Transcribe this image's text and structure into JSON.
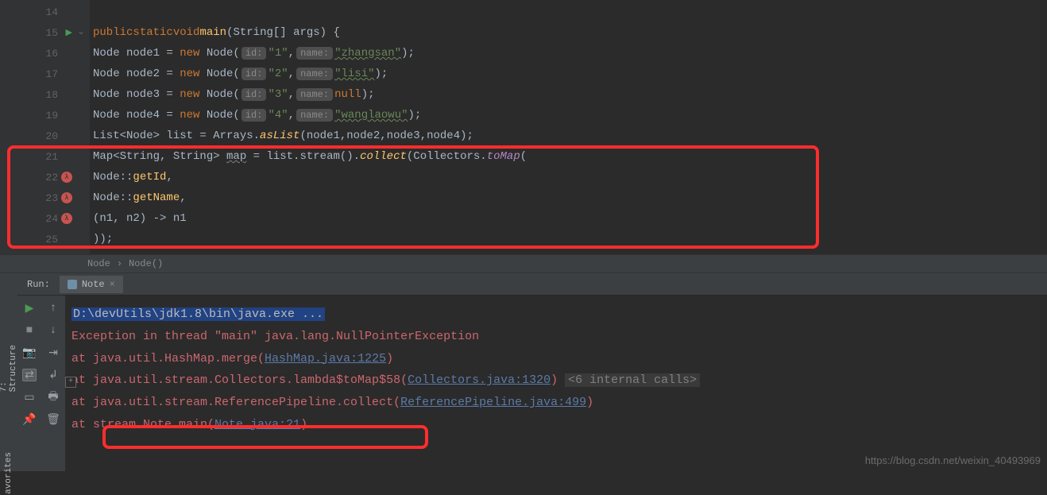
{
  "editor": {
    "lines": [
      14,
      15,
      16,
      17,
      18,
      19,
      20,
      21,
      22,
      23,
      24,
      25
    ],
    "line15_kw1": "public",
    "line15_kw2": "static",
    "line15_kw3": "void",
    "line15_method": "main",
    "line15_rest": "(String[] args) {",
    "line16_a": "Node node1 = ",
    "line16_new": "new ",
    "line16_b": "Node(",
    "line16_hint_id": "id:",
    "line16_id": "\"1\"",
    "line16_comma": ",",
    "line16_hint_name": "name:",
    "line16_name": "\"zhangsan\"",
    "line16_end": ");",
    "line17_a": "Node node2 = ",
    "line17_id": "\"2\"",
    "line17_name": "\"lisi\"",
    "line18_a": "Node node3 = ",
    "line18_id": "\"3\"",
    "line18_name": "null",
    "line19_a": "Node node4 = ",
    "line19_id": "\"4\"",
    "line19_name": "\"wanglaowu\"",
    "line20_a": "List<Node> list = Arrays.",
    "line20_asList": "asList",
    "line20_b": "(node1,node2,node3,node4);",
    "line21_a": "Map<String, String> ",
    "line21_map": "map",
    "line21_b": " = list.stream().",
    "line21_collect": "collect",
    "line21_c": "(Collectors.",
    "line21_toMap": "toMap",
    "line21_d": "(",
    "line22_a": "Node::",
    "line22_b": "getId",
    "line22_c": ",",
    "line23_a": "Node::",
    "line23_b": "getName",
    "line23_c": ",",
    "line24_a": "(n1, n2) -> n1",
    "line25_a": "));"
  },
  "breadcrumb": {
    "item1": "Node",
    "sep": "›",
    "item2": "Node()"
  },
  "run": {
    "label": "Run:",
    "tab_name": "Note",
    "close": "×"
  },
  "console": {
    "cmd": "D:\\devUtils\\jdk1.8\\bin\\java.exe ...",
    "exception": "Exception in thread \"main\" java.lang.NullPointerException",
    "at1_pre": "    at java.util.HashMap.merge(",
    "at1_link": "HashMap.java:1225",
    "at1_post": ")",
    "at2_pre": "    at java.util.stream.Collectors.lambda$toMap$58(",
    "at2_link": "Collectors.java:1320",
    "at2_post": ") ",
    "at2_extra": "<6 internal calls>",
    "at3_pre": "    at java.util.stream.ReferencePipeline.collect(",
    "at3_link": "ReferencePipeline.java:499",
    "at3_post": ")",
    "at4_pre": "    at stream.Note.main(",
    "at4_link": "Note.java:21",
    "at4_post": ")"
  },
  "sidebar": {
    "structure": "7: Structure",
    "favorites": "avorites"
  },
  "watermark": "https://blog.csdn.net/weixin_40493969"
}
